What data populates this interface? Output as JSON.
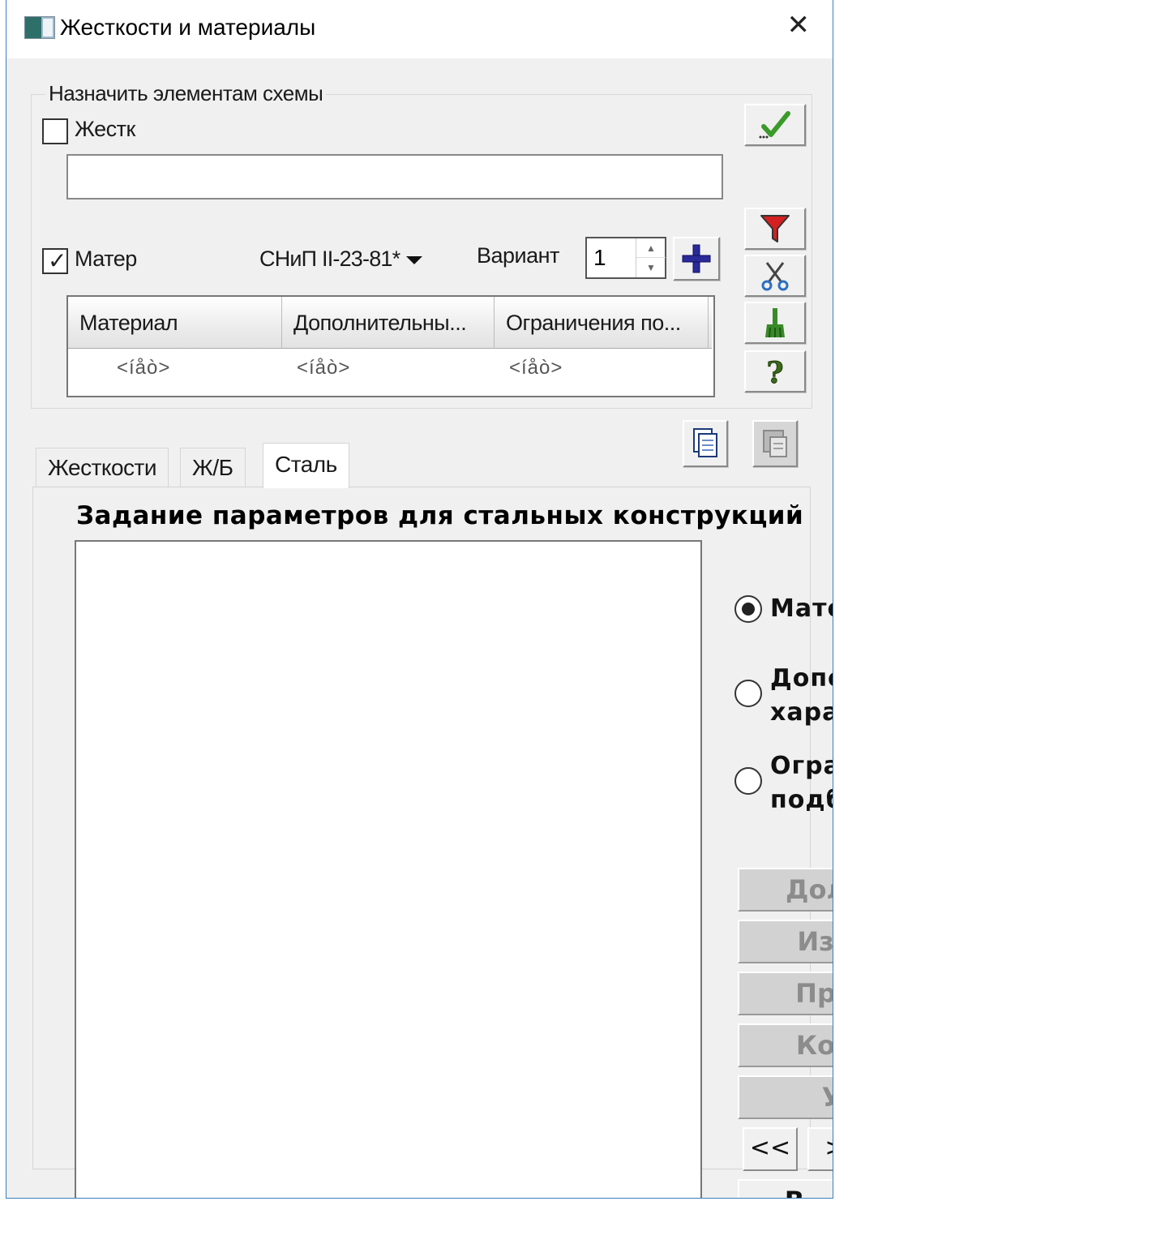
{
  "window": {
    "title": "Жесткости и материалы",
    "close_glyph": "✕"
  },
  "assign_group": {
    "legend": "Назначить элементам схемы",
    "stiffness_checkbox": {
      "label": "Жестк",
      "checked": false
    },
    "stiffness_value": "",
    "material_checkbox": {
      "label": "Матер",
      "checked": true
    },
    "norm_select": {
      "selected": "СНиП II-23-81*"
    },
    "variant": {
      "label": "Вариант",
      "value": "1"
    },
    "grid": {
      "columns": [
        "Материал",
        "Дополнительны...",
        "Ограничения по..."
      ],
      "cells": [
        "<íåò>",
        "<íåò>",
        "<íåò>"
      ]
    }
  },
  "toolbar": {
    "icons": [
      "apply-check-icon",
      "filter-icon",
      "scissors-icon",
      "brush-icon",
      "help-question-icon",
      "copy-icon",
      "paste-icon"
    ]
  },
  "tabs": [
    {
      "label": "Жесткости",
      "active": false
    },
    {
      "label": "Ж/Б",
      "active": false
    },
    {
      "label": "Сталь",
      "active": true
    }
  ],
  "steel_panel": {
    "title": "Задание параметров для стальных конструкций",
    "radios": [
      {
        "lines": [
          "Мате"
        ],
        "checked": true
      },
      {
        "lines": [
          "Допо",
          "хара"
        ],
        "checked": false
      },
      {
        "lines": [
          "Огра",
          "подб"
        ],
        "checked": false
      }
    ],
    "buttons": [
      "Дол",
      "Из",
      "Пр",
      "Ко",
      "У",
      "В"
    ],
    "nav": {
      "prev": "<<",
      "next": ">"
    }
  },
  "colors": {
    "window_border": "#3c7fc0",
    "dialog_bg": "#f0f0f0",
    "check_green": "#3a9a2a",
    "filter_red": "#d42020",
    "plus_blue": "#2a2a9a"
  }
}
